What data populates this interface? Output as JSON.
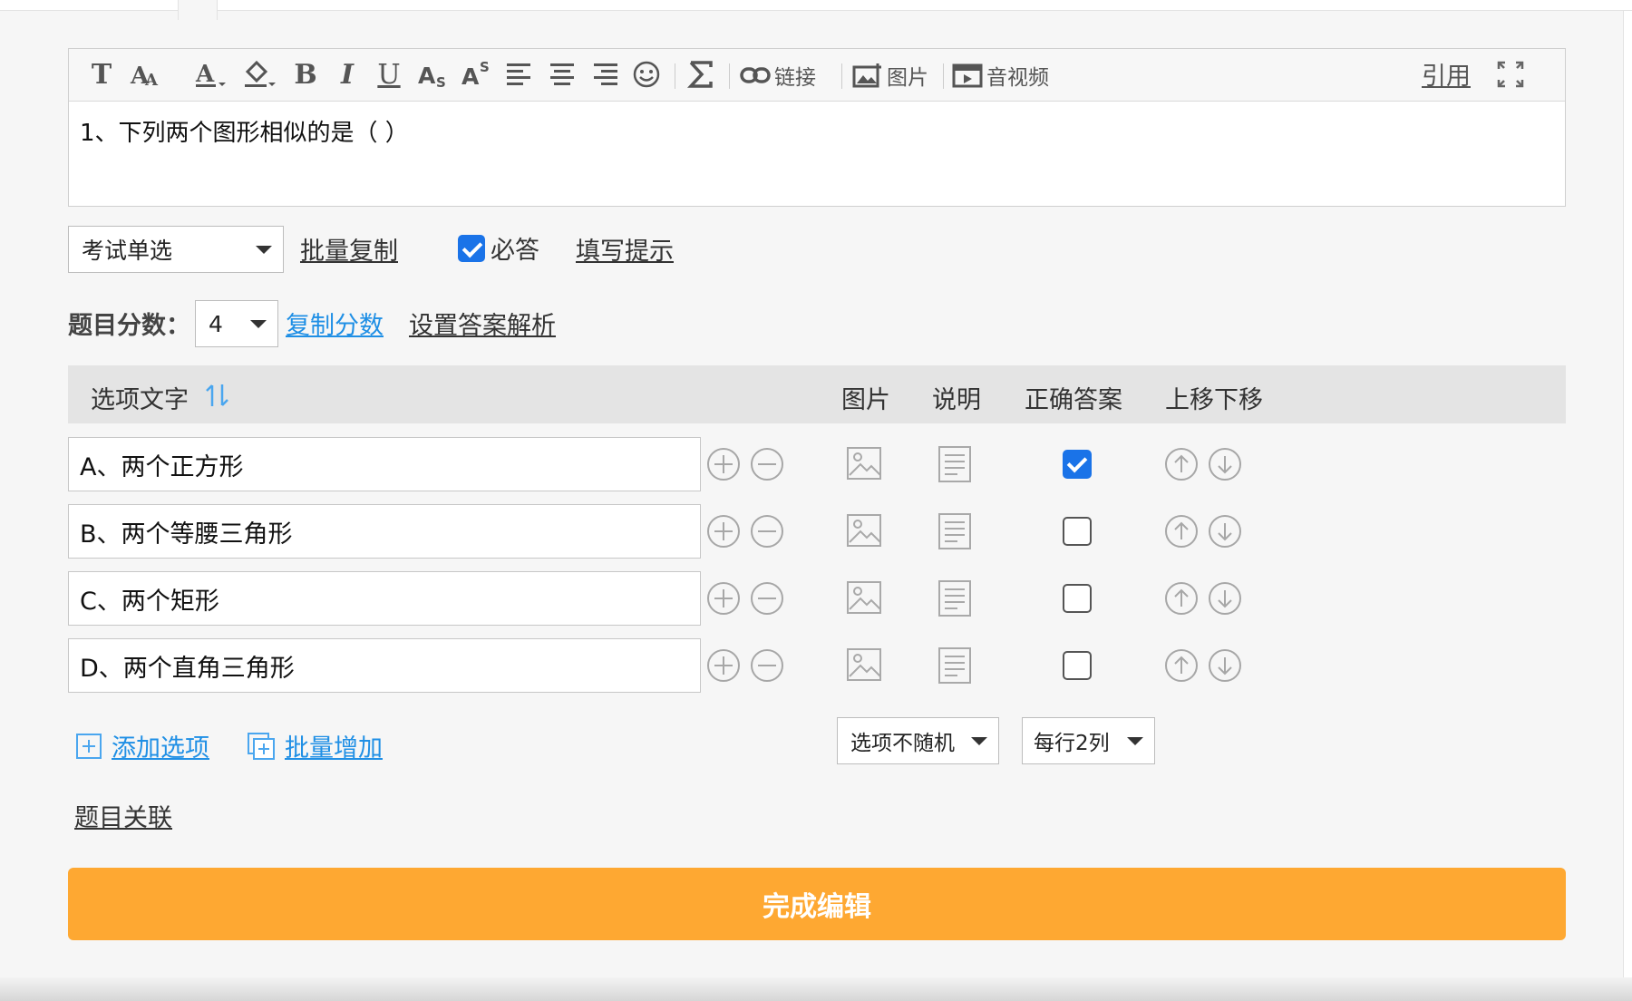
{
  "toolbar": {
    "link_label": "链接",
    "image_label": "图片",
    "media_label": "音视频",
    "cite_label": "引用"
  },
  "question": {
    "text": "1、下列两个图形相似的是（ ）"
  },
  "settings": {
    "question_type": "考试单选",
    "batch_copy": "批量复制",
    "required_checked": true,
    "required_label": "必答",
    "fill_hint": "填写提示",
    "score_label": "题目分数：",
    "score_value": "4",
    "copy_score": "复制分数",
    "set_analysis": "设置答案解析"
  },
  "options_header": {
    "option_text": "选项文字",
    "image": "图片",
    "note": "说明",
    "correct": "正确答案",
    "move": "上移下移"
  },
  "options": [
    {
      "text": "A、两个正方形",
      "correct": true
    },
    {
      "text": "B、两个等腰三角形",
      "correct": false
    },
    {
      "text": "C、两个矩形",
      "correct": false
    },
    {
      "text": "D、两个直角三角形",
      "correct": false
    }
  ],
  "footer": {
    "add_option": "添加选项",
    "batch_add": "批量增加",
    "random_select": "选项不随机",
    "columns_select": "每行2列",
    "relation": "题目关联",
    "done": "完成编辑"
  },
  "colors": {
    "accent_blue": "#1f8fe5",
    "checkbox_blue": "#1a73e8",
    "done_orange": "#fea832"
  }
}
